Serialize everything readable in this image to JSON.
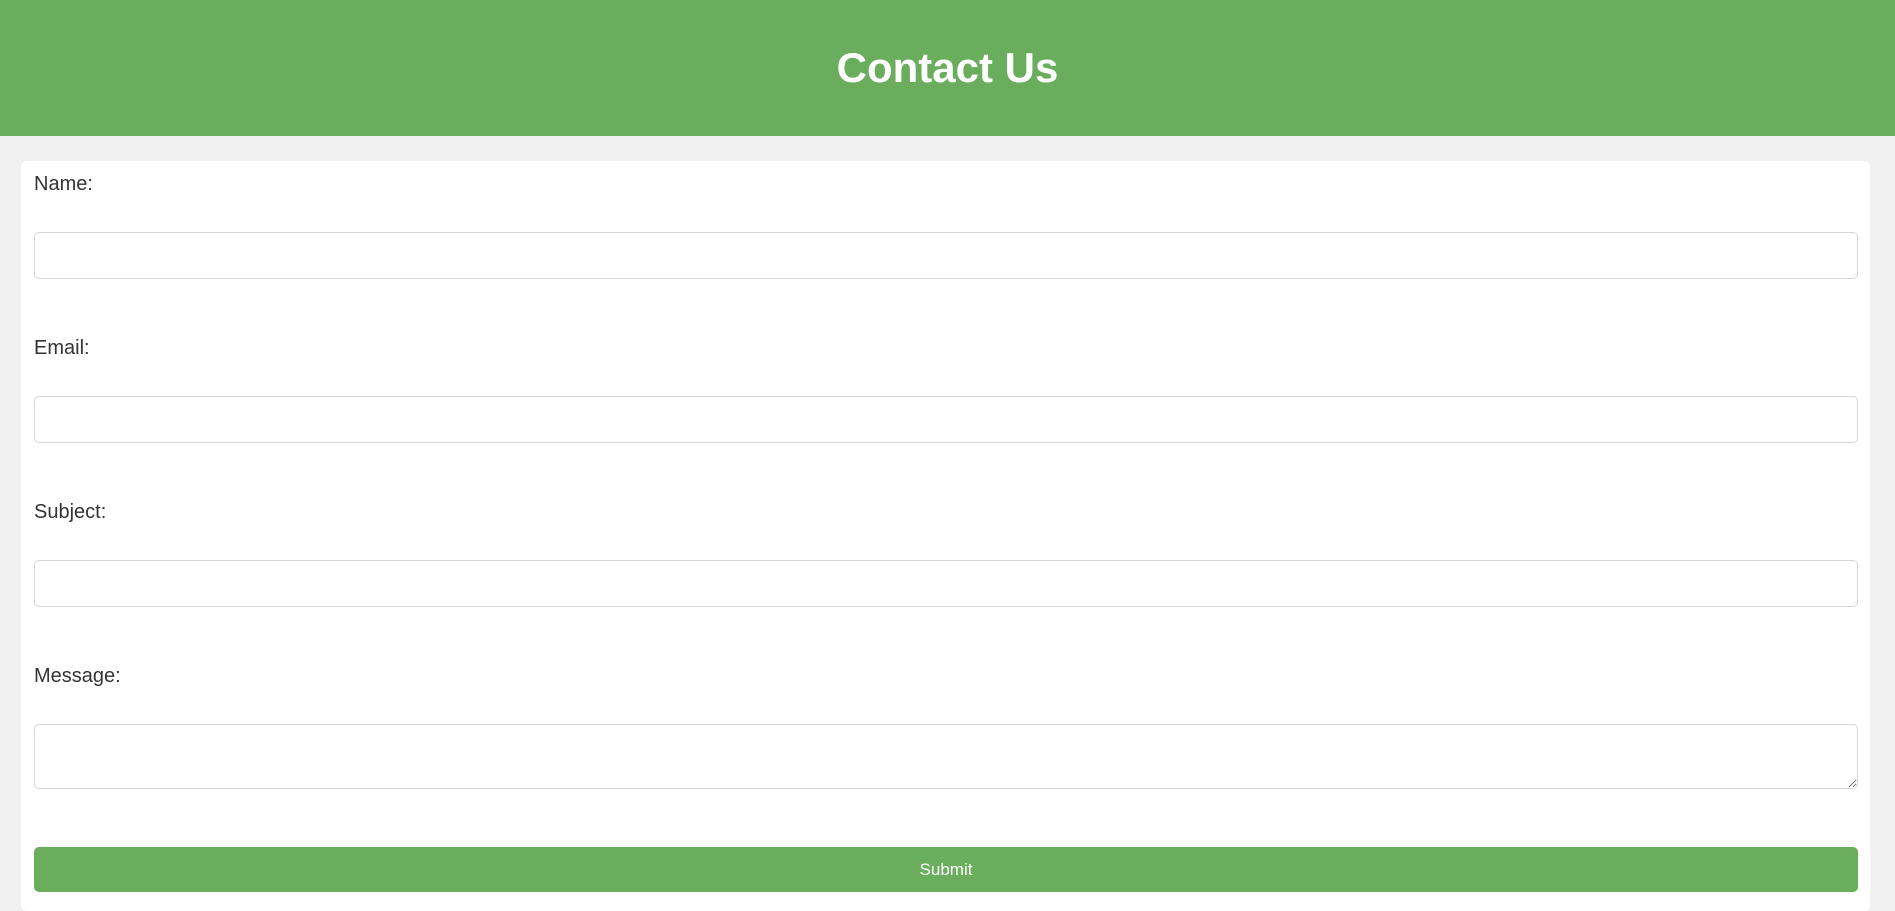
{
  "header": {
    "title": "Contact Us"
  },
  "form": {
    "name_label": "Name:",
    "name_value": "",
    "email_label": "Email:",
    "email_value": "",
    "subject_label": "Subject:",
    "subject_value": "",
    "message_label": "Message:",
    "message_value": "",
    "submit_label": "Submit"
  },
  "colors": {
    "accent": "#6aad5c",
    "background": "#f1f1f1",
    "card": "#ffffff"
  }
}
